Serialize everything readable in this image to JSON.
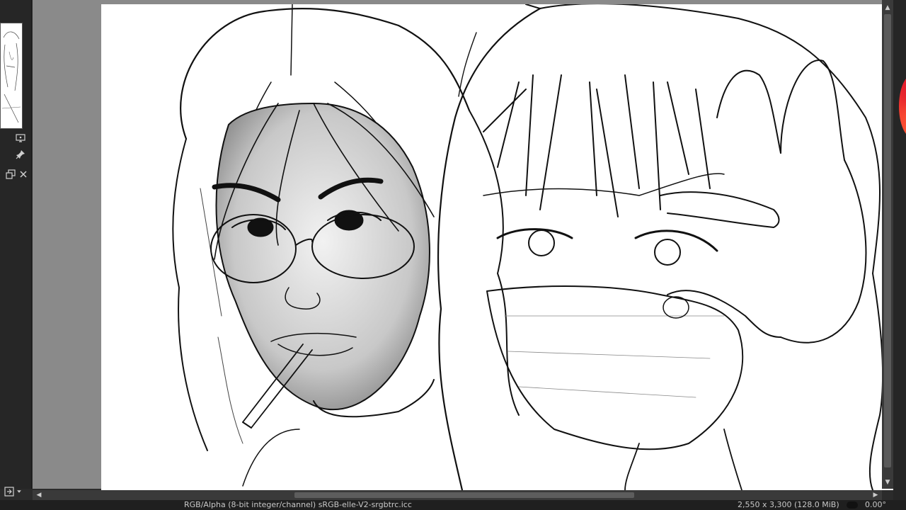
{
  "left_dock": {
    "icons": [
      "monitor-icon",
      "pin-icon",
      "float-icon",
      "close-icon",
      "tool-options-icon"
    ]
  },
  "canvas": {
    "description_color": "#ffffff",
    "background_color": "#8a8a8a"
  },
  "status": {
    "color_model": "RGB/Alpha (8-bit integer/channel)  sRGB-elle-V2-srgbtrc.icc",
    "size": "2,550 x 3,300 (128.0 MiB)",
    "zoom": "0.00°"
  },
  "colors": {
    "dock_bg": "#262626",
    "status_bg": "#1f1f1f",
    "accent_wheel": "#e0182c"
  }
}
